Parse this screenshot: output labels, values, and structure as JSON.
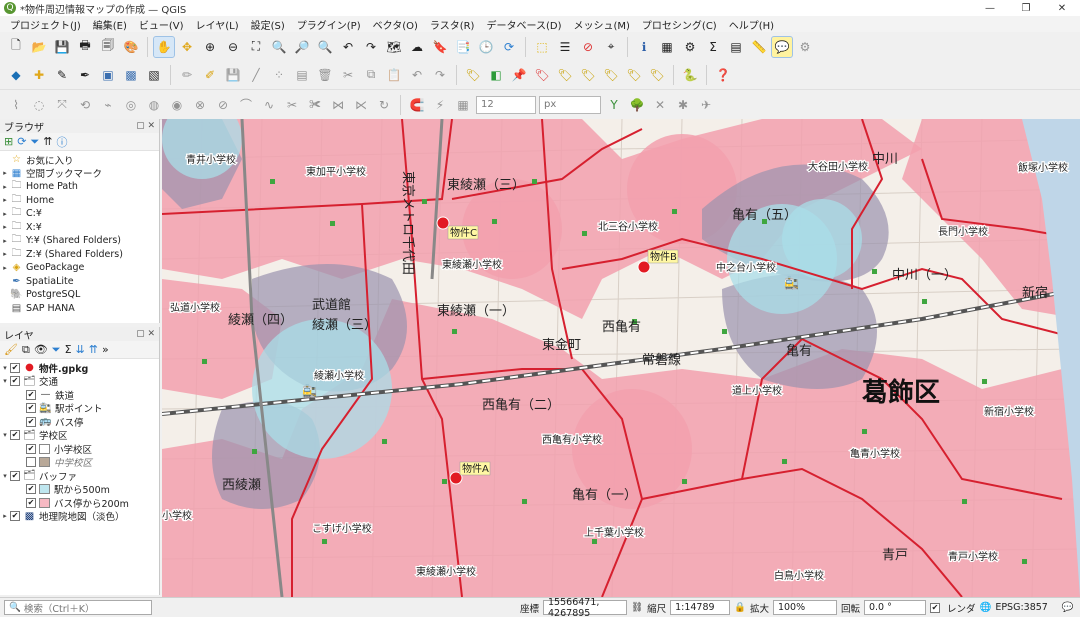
{
  "window": {
    "title": "*物件周辺情報マップの作成 — QGIS",
    "min": "—",
    "max": "❐",
    "close": "✕"
  },
  "menu": [
    "プロジェクト(J)",
    "編集(E)",
    "ビュー(V)",
    "レイヤ(L)",
    "設定(S)",
    "プラグイン(P)",
    "ベクタ(O)",
    "ラスタ(R)",
    "データベース(D)",
    "メッシュ(M)",
    "プロセシング(C)",
    "ヘルプ(H)"
  ],
  "toolbar3": {
    "size_value": "12",
    "unit_value": "px"
  },
  "browser": {
    "title": "ブラウザ",
    "items": [
      {
        "label": "お気に入り",
        "icon": "star-icon",
        "expander": ""
      },
      {
        "label": "空間ブックマーク",
        "icon": "bookmark-icon",
        "expander": "▸"
      },
      {
        "label": "Home Path",
        "icon": "folder-icon",
        "expander": "▸"
      },
      {
        "label": "Home",
        "icon": "folder-icon",
        "expander": "▸"
      },
      {
        "label": "C:¥",
        "icon": "folder-icon",
        "expander": "▸"
      },
      {
        "label": "X:¥",
        "icon": "folder-icon",
        "expander": "▸"
      },
      {
        "label": "Y:¥ (Shared Folders)",
        "icon": "folder-icon",
        "expander": "▸"
      },
      {
        "label": "Z:¥ (Shared Folders)",
        "icon": "folder-icon",
        "expander": "▸"
      },
      {
        "label": "GeoPackage",
        "icon": "geopackage-icon",
        "expander": "▸"
      },
      {
        "label": "SpatiaLite",
        "icon": "spatialite-icon",
        "expander": ""
      },
      {
        "label": "PostgreSQL",
        "icon": "postgresql-icon",
        "expander": ""
      },
      {
        "label": "SAP HANA",
        "icon": "database-icon",
        "expander": ""
      }
    ]
  },
  "layers": {
    "title": "レイヤ",
    "items": [
      {
        "label": "物件.gpkg",
        "indent": 0,
        "expander": "▾",
        "swatch": "#e21b23",
        "bold": true,
        "italic": false
      },
      {
        "label": "交通",
        "indent": 0,
        "expander": "▾",
        "swatch": "group",
        "bold": false,
        "italic": false
      },
      {
        "label": "鉄道",
        "indent": 1,
        "expander": "",
        "swatch": "line",
        "bold": false,
        "italic": false
      },
      {
        "label": "駅ポイント",
        "indent": 1,
        "expander": "",
        "swatch": "train",
        "bold": false,
        "italic": false
      },
      {
        "label": "バス停",
        "indent": 1,
        "expander": "",
        "swatch": "bus",
        "bold": false,
        "italic": false
      },
      {
        "label": "学校区",
        "indent": 0,
        "expander": "▾",
        "swatch": "group",
        "bold": false,
        "italic": false
      },
      {
        "label": "小学校区",
        "indent": 1,
        "expander": "",
        "swatch": "#ffffff",
        "bold": false,
        "italic": false
      },
      {
        "label": "中学校区",
        "indent": 1,
        "expander": "",
        "swatch": "#b8a898",
        "bold": false,
        "italic": true
      },
      {
        "label": "バッファ",
        "indent": 0,
        "expander": "▾",
        "swatch": "group",
        "bold": false,
        "italic": false
      },
      {
        "label": "駅から500m",
        "indent": 1,
        "expander": "",
        "swatch": "#bfe6ef",
        "bold": false,
        "italic": false
      },
      {
        "label": "バス停から200m",
        "indent": 1,
        "expander": "",
        "swatch": "#f7b9c3",
        "bold": false,
        "italic": false
      },
      {
        "label": "地理院地図（淡色）",
        "indent": 0,
        "expander": "▸",
        "swatch": "tile",
        "bold": false,
        "italic": false
      }
    ]
  },
  "map": {
    "properties": [
      "物件C",
      "物件B",
      "物件A"
    ],
    "ward": "葛飾区",
    "schools": [
      "青井小学校",
      "東加平小学校",
      "大谷田小学校",
      "飯塚小学校",
      "北三谷小学校",
      "長門小学校",
      "中之台小学校",
      "東綾瀬小学校",
      "弘道小学校",
      "綾瀬小学校",
      "道上小学校",
      "新宿小学校",
      "西亀有小学校",
      "亀青小学校",
      "こすげ小学校",
      "上千葉小学校",
      "青戸小学校",
      "白鳥小学校",
      "東綾瀬小学校",
      "小学校"
    ],
    "areas": [
      "東綾瀬（三）",
      "東綾瀬（一）",
      "綾瀬（三）",
      "綾瀬（四）",
      "西亀有",
      "西亀有（二）",
      "亀有（五）",
      "亀有",
      "新宿",
      "中川（一）",
      "東金町",
      "亀有（一）",
      "武道館",
      "東京メトロ千代田",
      "常磐線",
      "中川",
      "青戸",
      "西綾瀬"
    ]
  },
  "status": {
    "search_placeholder": "検索（Ctrl＋K）",
    "coord_label": "座標",
    "coord_value": "15566471, 4267895",
    "scale_label": "縮尺",
    "scale_value": "1:14789",
    "mag_label": "拡大",
    "mag_value": "100%",
    "rotation_label": "回転",
    "rotation_value": "0.0 °",
    "render_label": "レンダ",
    "crs": "EPSG:3857"
  }
}
